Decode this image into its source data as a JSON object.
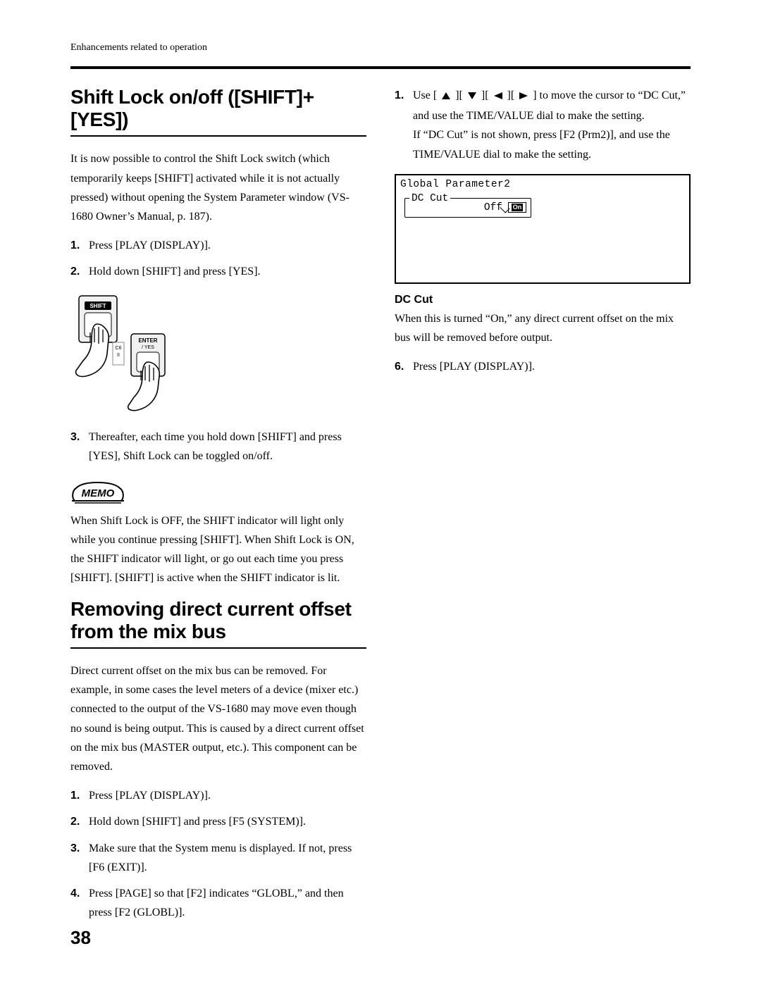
{
  "header": {
    "running_head": "Enhancements related to operation"
  },
  "left": {
    "h1": "Shift Lock on/off ([SHIFT]+[YES])",
    "intro": "It is now possible to control the Shift Lock switch (which temporarily keeps [SHIFT] activated while it is not actually pressed) without opening the System Parameter window (VS-1680 Owner’s Manual, p. 187).",
    "steps1": [
      "Press [PLAY (DISPLAY)].",
      "Hold down [SHIFT] and press [YES]."
    ],
    "illus": {
      "shift_label": "SHIFT",
      "enter_label": "ENTER / YES",
      "locator_label": "C6 / II"
    },
    "steps2": [
      "Thereafter, each time you hold down [SHIFT] and press [YES], Shift Lock can be toggled on/off."
    ],
    "memo_label": "MEMO",
    "memo_text": "When Shift Lock is OFF, the SHIFT indicator will light only while you continue pressing [SHIFT]. When Shift Lock is ON, the SHIFT indicator will light, or go out each time you press [SHIFT]. [SHIFT] is active when the SHIFT indicator is lit.",
    "h2": "Removing direct current offset from the mix bus",
    "intro2": "Direct current offset on the mix bus can be removed. For example, in some cases the level meters of a device (mixer etc.) connected to the output of the VS-1680 may move even though no sound is being output. This is caused by a direct current offset on the mix bus (MASTER output, etc.). This component can be removed.",
    "steps3": [
      "Press [PLAY (DISPLAY)].",
      "Hold down [SHIFT] and press [F5 (SYSTEM)].",
      "Make sure that the System menu is displayed. If not, press [F6 (EXIT)].",
      "Press [PAGE] so that [F2] indicates “GLOBL,” and then press [F2 (GLOBL)]."
    ]
  },
  "right": {
    "step5_pre": "Use [",
    "step5_mid1": "][",
    "step5_mid2": "][",
    "step5_mid3": "][",
    "step5_post": " ] to move the cursor to “DC Cut,” and use the TIME/VALUE dial to make the setting.",
    "step5_note": "If “DC Cut” is not shown, press [F2 (Prm2)], and use the TIME/VALUE dial to make the setting.",
    "lcd": {
      "title": "Global Parameter2",
      "group_label": "DC Cut",
      "off_value": "Off",
      "on_box": "On"
    },
    "dccut_head": "DC Cut",
    "dccut_body": "When this is turned “On,” any direct current offset on the mix bus will be removed before output.",
    "steps6": [
      "Press [PLAY (DISPLAY)]."
    ]
  },
  "page_number": "38"
}
